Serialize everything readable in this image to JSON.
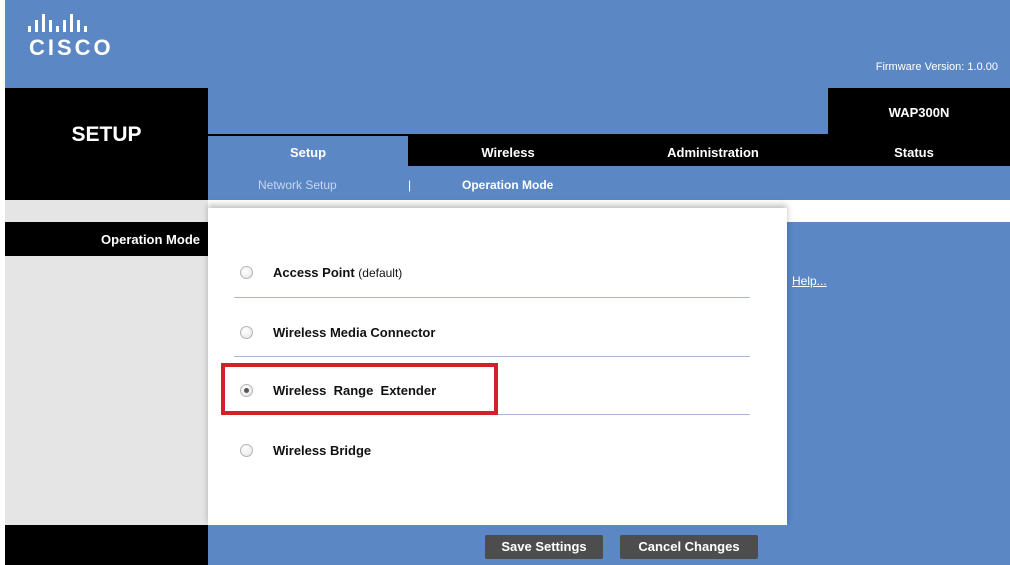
{
  "header": {
    "logo_text": "CISCO",
    "firmware": "Firmware Version: 1.0.00",
    "page_title": "SETUP",
    "model": "WAP300N"
  },
  "tabs": [
    {
      "label": "Setup",
      "active": true
    },
    {
      "label": "Wireless",
      "active": false
    },
    {
      "label": "Administration",
      "active": false
    },
    {
      "label": "Status",
      "active": false
    }
  ],
  "subnav": {
    "items": [
      {
        "label": "Network Setup",
        "active": false
      },
      {
        "label": "Operation Mode",
        "active": true
      }
    ],
    "separator": "|"
  },
  "section": {
    "label": "Operation Mode"
  },
  "options": [
    {
      "label": "Access Point",
      "suffix": "(default)",
      "checked": false
    },
    {
      "label": "Wireless Media Connector",
      "suffix": "",
      "checked": false
    },
    {
      "label": "Wireless  Range  Extender",
      "suffix": "",
      "checked": true
    },
    {
      "label": "Wireless Bridge",
      "suffix": "",
      "checked": false
    }
  ],
  "help": {
    "label": "Help..."
  },
  "buttons": {
    "save": "Save Settings",
    "cancel": "Cancel Changes"
  },
  "colors": {
    "brand_blue": "#5b87c5",
    "highlight_red": "#d21f2b",
    "button_gray": "#4d4d4d"
  }
}
